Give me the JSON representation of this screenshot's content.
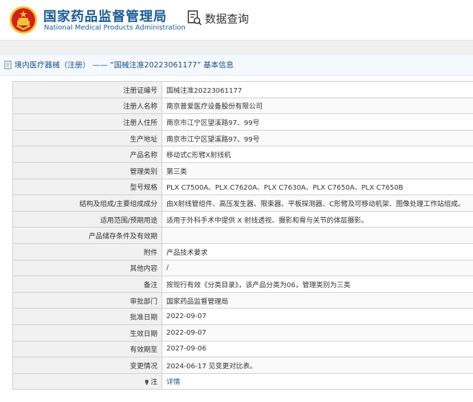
{
  "header": {
    "org_name_cn": "国家药品监督管理局",
    "org_name_en": "National Medical Products Administration",
    "search_label": "数据查询",
    "emblem_icon": "national-emblem",
    "search_icon": "document-search-icon"
  },
  "breadcrumb": {
    "text": "境内医疗器械（注册） —— “国械注准20223061177” 基本信息",
    "icon": "document-icon"
  },
  "records": [
    {
      "label": "注册证编号",
      "value": "国械注准20223061177"
    },
    {
      "label": "注册人名称",
      "value": "南京普爱医疗设备股份有限公司"
    },
    {
      "label": "注册人住所",
      "value": "南京市江宁区望溪路97、99号"
    },
    {
      "label": "生产地址",
      "value": "南京市江宁区望溪路97、99号"
    },
    {
      "label": "产品名称",
      "value": "移动式C形臂X射线机"
    },
    {
      "label": "管理类别",
      "value": "第三类"
    },
    {
      "label": "型号规格",
      "value": "PLX C7500A、PLX C7620A、PLX C7630A、PLX C7650A、PLX C7650B"
    },
    {
      "label": "结构及组成/主要组成成分",
      "value": "由X射线管组件、高压发生器、限束器、平板探测器、C形臂及可移动机架、图像处理工作站组成。"
    },
    {
      "label": "适用范围/预期用途",
      "value": "适用于外科手术中提供 X 射线透视、摄影和骨与关节的体层摄影。"
    },
    {
      "label": "产品储存条件及有效期",
      "value": ""
    },
    {
      "label": "附件",
      "value": "产品技术要求"
    },
    {
      "label": "其他内容",
      "value": "/"
    },
    {
      "label": "备注",
      "value": "按现行有效《分类目录》，该产品分类为06，管理类别为三类"
    },
    {
      "label": "审批部门",
      "value": "国家药品监督管理局"
    },
    {
      "label": "批准日期",
      "value": "2022-09-07"
    },
    {
      "label": "生效日期",
      "value": "2022-09-07"
    },
    {
      "label": "有效期至",
      "value": "2027-09-06"
    },
    {
      "label": "变更情况",
      "value": "2024-06-17 见变更对比表。"
    }
  ],
  "note_row": {
    "label": "注",
    "link": "详情",
    "icon": "pin-icon"
  },
  "colors": {
    "brand_blue": "#1a5a96",
    "emblem_red": "#d21f1f",
    "emblem_gold": "#f2c230"
  }
}
